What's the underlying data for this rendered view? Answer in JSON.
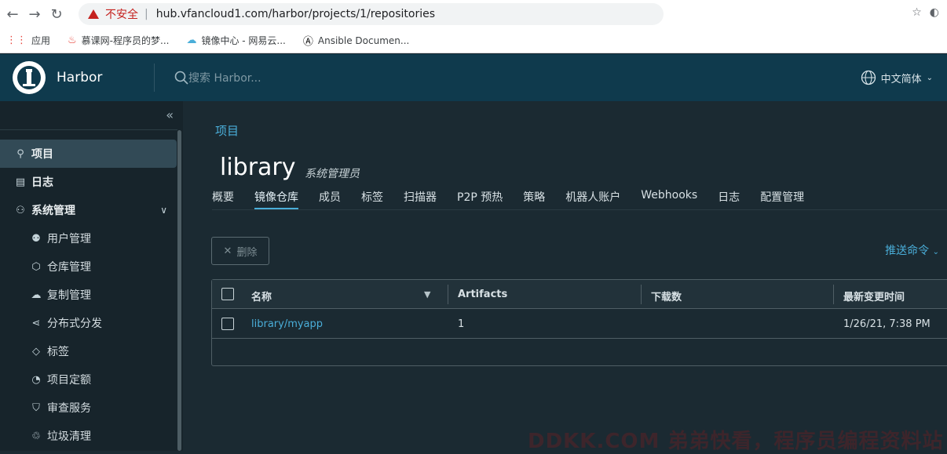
{
  "browser": {
    "security_label": "不安全",
    "url": "hub.vfancloud1.com/harbor/projects/1/repositories",
    "bookmarks": [
      {
        "label": "应用",
        "icon": "apps-grid-icon"
      },
      {
        "label": "慕课网-程序员的梦...",
        "icon": "flame-icon"
      },
      {
        "label": "镜像中心 - 网易云...",
        "icon": "cloud-icon"
      },
      {
        "label": "Ansible Documen...",
        "icon": "ansible-icon"
      }
    ]
  },
  "header": {
    "brand": "Harbor",
    "search_placeholder": "搜索 Harbor...",
    "language": "中文简体"
  },
  "sidebar": {
    "items": [
      {
        "label": "项目",
        "icon": "projects-icon"
      },
      {
        "label": "日志",
        "icon": "log-icon"
      },
      {
        "label": "系统管理",
        "icon": "admin-icon"
      },
      {
        "label": "用户管理",
        "icon": "users-icon"
      },
      {
        "label": "仓库管理",
        "icon": "registry-icon"
      },
      {
        "label": "复制管理",
        "icon": "replication-icon"
      },
      {
        "label": "分布式分发",
        "icon": "distribution-icon"
      },
      {
        "label": "标签",
        "icon": "tag-icon"
      },
      {
        "label": "项目定额",
        "icon": "quota-icon"
      },
      {
        "label": "审查服务",
        "icon": "shield-icon"
      },
      {
        "label": "垃圾清理",
        "icon": "trash-icon"
      }
    ]
  },
  "main": {
    "breadcrumb": "项目",
    "project_name": "library",
    "role": "系统管理员",
    "tabs": [
      "概要",
      "镜像仓库",
      "成员",
      "标签",
      "扫描器",
      "P2P 预热",
      "策略",
      "机器人账户",
      "Webhooks",
      "日志",
      "配置管理"
    ],
    "delete_label": "删除",
    "push_command_label": "推送命令",
    "table": {
      "headers": [
        "名称",
        "Artifacts",
        "下载数",
        "最新变更时间"
      ],
      "rows": [
        {
          "name": "library/myapp",
          "artifacts": "1",
          "downloads": "",
          "updated": "1/26/21, 7:38 PM"
        }
      ]
    }
  },
  "watermark": "DDKK.COM 弟弟快看，程序员编程资料站",
  "colors": {
    "header_bg": "#0f3a4d",
    "accent": "#4aaed9",
    "sidebar_bg": "#17242b",
    "main_bg": "#1b2a32"
  }
}
